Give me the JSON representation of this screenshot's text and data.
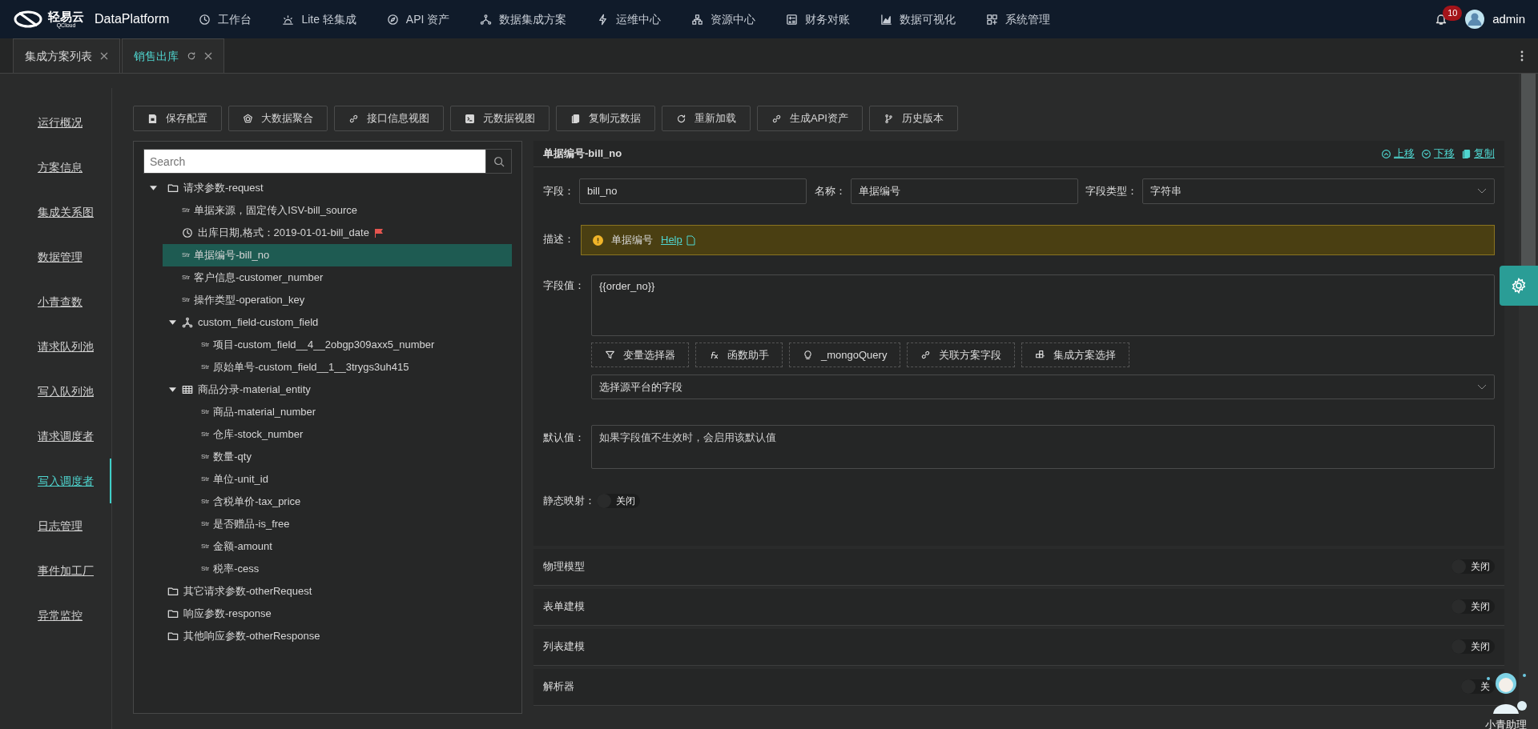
{
  "app": {
    "logo": "轻易云",
    "logo_sub": "QCloud",
    "name": "DataPlatform"
  },
  "nav": [
    {
      "label": "工作台"
    },
    {
      "label": "Lite 轻集成"
    },
    {
      "label": "API 资产"
    },
    {
      "label": "数据集成方案"
    },
    {
      "label": "运维中心"
    },
    {
      "label": "资源中心"
    },
    {
      "label": "财务对账"
    },
    {
      "label": "数据可视化"
    },
    {
      "label": "系统管理"
    }
  ],
  "notifications": {
    "count": "10"
  },
  "user": {
    "name": "admin"
  },
  "tabs": [
    {
      "label": "集成方案列表",
      "selected": false,
      "reload": false
    },
    {
      "label": "销售出库",
      "selected": true,
      "reload": true
    }
  ],
  "sidebar": {
    "items": [
      {
        "label": "运行概况",
        "selected": false
      },
      {
        "label": "方案信息",
        "selected": false
      },
      {
        "label": "集成关系图",
        "selected": false
      },
      {
        "label": "数据管理",
        "selected": false
      },
      {
        "label": "小青查数",
        "selected": false
      },
      {
        "label": "请求队列池",
        "selected": false
      },
      {
        "label": "写入队列池",
        "selected": false
      },
      {
        "label": "请求调度者",
        "selected": false
      },
      {
        "label": "写入调度者",
        "selected": true
      },
      {
        "label": "日志管理",
        "selected": false
      },
      {
        "label": "事件加工厂",
        "selected": false
      },
      {
        "label": "异常监控",
        "selected": false
      }
    ]
  },
  "toolbar": [
    {
      "label": "保存配置"
    },
    {
      "label": "大数据聚合"
    },
    {
      "label": "接口信息视图"
    },
    {
      "label": "元数据视图"
    },
    {
      "label": "复制元数据"
    },
    {
      "label": "重新加载"
    },
    {
      "label": "生成API资产"
    },
    {
      "label": "历史版本"
    }
  ],
  "tree": {
    "search": {
      "placeholder": "Search"
    },
    "nodes": [
      {
        "kind": "folder",
        "label": "请求参数-request",
        "expanded": true,
        "selected": false,
        "children": [
          {
            "kind": "str",
            "badge": "Str",
            "label": "单据来源，固定传入ISV-bill_source",
            "selected": false
          },
          {
            "kind": "date",
            "label": "出库日期,格式：2019-01-01-bill_date",
            "flag": true,
            "selected": false
          },
          {
            "kind": "str",
            "badge": "Str",
            "label": "单据编号-bill_no",
            "selected": true
          },
          {
            "kind": "str",
            "badge": "Str",
            "label": "客户信息-customer_number",
            "selected": false
          },
          {
            "kind": "str",
            "badge": "Str",
            "label": "操作类型-operation_key",
            "selected": false
          },
          {
            "kind": "object",
            "label": "custom_field-custom_field",
            "expanded": true,
            "selected": false,
            "children": [
              {
                "kind": "str",
                "badge": "Str",
                "label": "项目-custom_field__4__2obgp309axx5_number",
                "selected": false
              },
              {
                "kind": "str",
                "badge": "Str",
                "label": "原始单号-custom_field__1__3trygs3uh415",
                "selected": false
              }
            ]
          },
          {
            "kind": "table",
            "label": "商品分录-material_entity",
            "expanded": true,
            "selected": false,
            "children": [
              {
                "kind": "str",
                "badge": "Str",
                "label": "商品-material_number",
                "selected": false
              },
              {
                "kind": "str",
                "badge": "Str",
                "label": "仓库-stock_number",
                "selected": false
              },
              {
                "kind": "str",
                "badge": "Str",
                "label": "数量-qty",
                "selected": false
              },
              {
                "kind": "str",
                "badge": "Str",
                "label": "单位-unit_id",
                "selected": false
              },
              {
                "kind": "str",
                "badge": "Str",
                "label": "含税单价-tax_price",
                "selected": false
              },
              {
                "kind": "str",
                "badge": "Str",
                "label": "是否赠品-is_free",
                "selected": false
              },
              {
                "kind": "str",
                "badge": "Str",
                "label": "金额-amount",
                "selected": false
              },
              {
                "kind": "str",
                "badge": "Str",
                "label": "税率-cess",
                "selected": false
              }
            ]
          }
        ]
      },
      {
        "kind": "folder",
        "label": "其它请求参数-otherRequest",
        "selected": false
      },
      {
        "kind": "folder",
        "label": "响应参数-response",
        "selected": false
      },
      {
        "kind": "folder",
        "label": "其他响应参数-otherResponse",
        "selected": false
      }
    ]
  },
  "field_panel": {
    "title": "单据编号-bill_no",
    "actions": [
      {
        "label": "上移"
      },
      {
        "label": "下移"
      },
      {
        "label": "复制"
      }
    ],
    "field": {
      "label": "字段：",
      "value": "bill_no"
    },
    "name": {
      "label": "名称：",
      "value": "单据编号"
    },
    "type": {
      "label": "字段类型：",
      "value": "字符串"
    },
    "description": {
      "label": "描述：",
      "text": "单据编号",
      "link": "Help"
    },
    "value": {
      "label": "字段值：",
      "value": "{{order_no}}"
    },
    "helpers": [
      {
        "label": "变量选择器"
      },
      {
        "label": "函数助手"
      },
      {
        "label": "_mongoQuery"
      },
      {
        "label": "关联方案字段"
      },
      {
        "label": "集成方案选择"
      }
    ],
    "source_select": {
      "placeholder": "选择源平台的字段"
    },
    "default": {
      "label": "默认值：",
      "placeholder": "如果字段值不生效时，会启用该默认值"
    },
    "static_map": {
      "label": "静态映射：",
      "on": false,
      "state_text": "关闭"
    }
  },
  "sections": [
    {
      "title": "物理模型",
      "on": false,
      "state_text": "关闭"
    },
    {
      "title": "表单建模",
      "on": false,
      "state_text": "关闭"
    },
    {
      "title": "列表建模",
      "on": false,
      "state_text": "关闭"
    },
    {
      "title": "解析器",
      "on": false,
      "state_text": "关"
    }
  ],
  "assistant": {
    "label": "小青助理"
  }
}
